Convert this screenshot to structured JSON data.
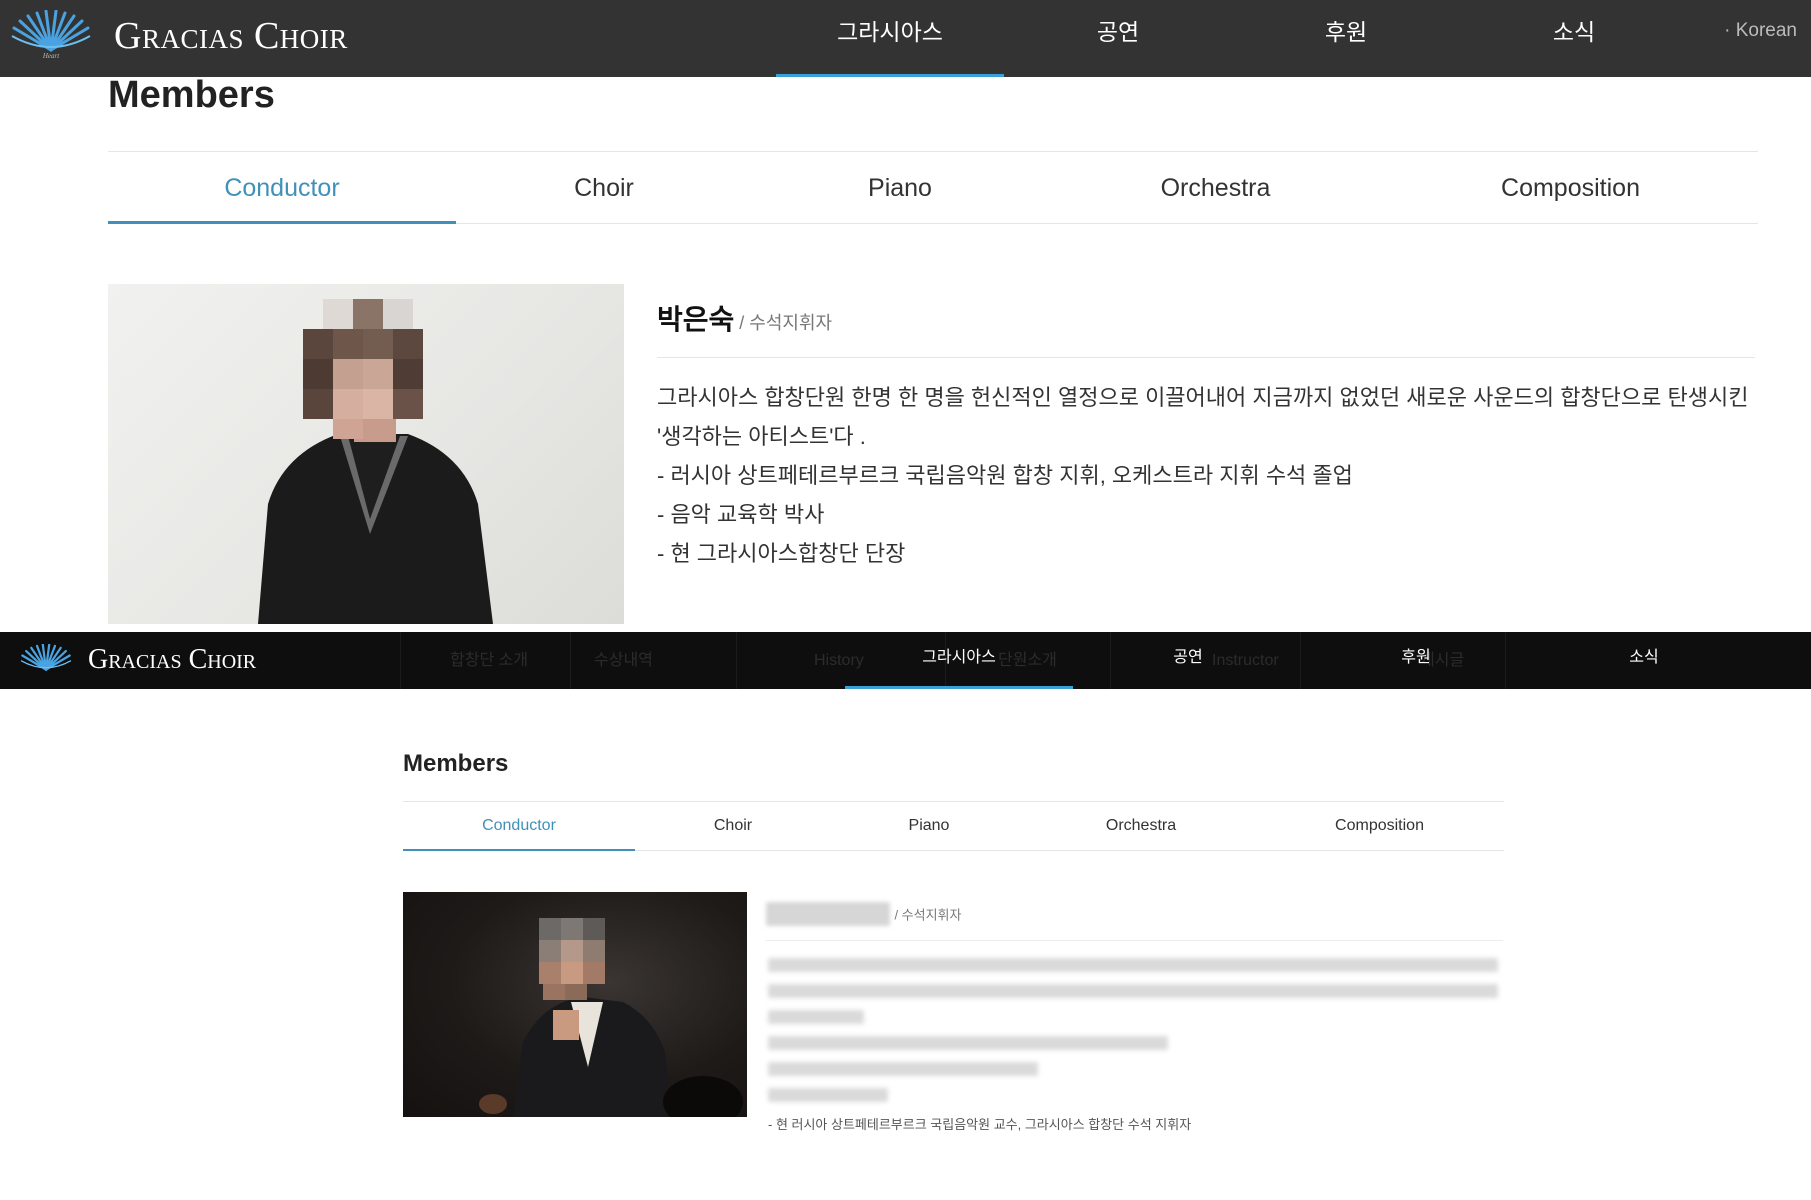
{
  "top": {
    "brand": "Gracias Choir",
    "nav": [
      "그라시아스",
      "공연",
      "후원",
      "소식"
    ],
    "nav_active": 0,
    "lang": "· Korean",
    "page_title": "Members",
    "tabs": [
      "Conductor",
      "Choir",
      "Piano",
      "Orchestra",
      "Composition"
    ],
    "active_tab": 0,
    "member": {
      "name": "박은숙",
      "role": " / 수석지휘자",
      "bio": [
        "그라시아스 합창단원 한명 한 명을 헌신적인 열정으로 이끌어내어 지금까지 없었던 새로운 사운드의 합창단으로 탄생시킨 '생각하는 아티스트'다 .",
        "- 러시아 상트페테르부르크 국립음악원 합창 지휘, 오케스트라 지휘 수석 졸업",
        "- 음악 교육학 박사",
        "- 현 그라시아스합창단 단장"
      ]
    }
  },
  "bottom": {
    "brand": "Gracias Choir",
    "nav": [
      "그라시아스",
      "공연",
      "후원",
      "소식"
    ],
    "nav_active": 0,
    "submenu_faded": [
      "합창단 소개",
      "수상내역",
      "History",
      "단원소개",
      "Instructor",
      "게시글"
    ],
    "page_title": "Members",
    "tabs": [
      "Conductor",
      "Choir",
      "Piano",
      "Orchestra",
      "Composition"
    ],
    "active_tab": 0,
    "member": {
      "role": "/ 수석지휘자",
      "bio_last": "- 현 러시아 상트페테르부르크 국립음악원 교수, 그라시아스 합창단 수석 지휘자"
    }
  },
  "colors": {
    "nav_top_bg": "#333333",
    "nav_bottom_bg": "#0e0e0e",
    "accent": "#3f91b9",
    "nav_underline": "#3aa0d8",
    "logo_blue": "#4aa3e0"
  }
}
